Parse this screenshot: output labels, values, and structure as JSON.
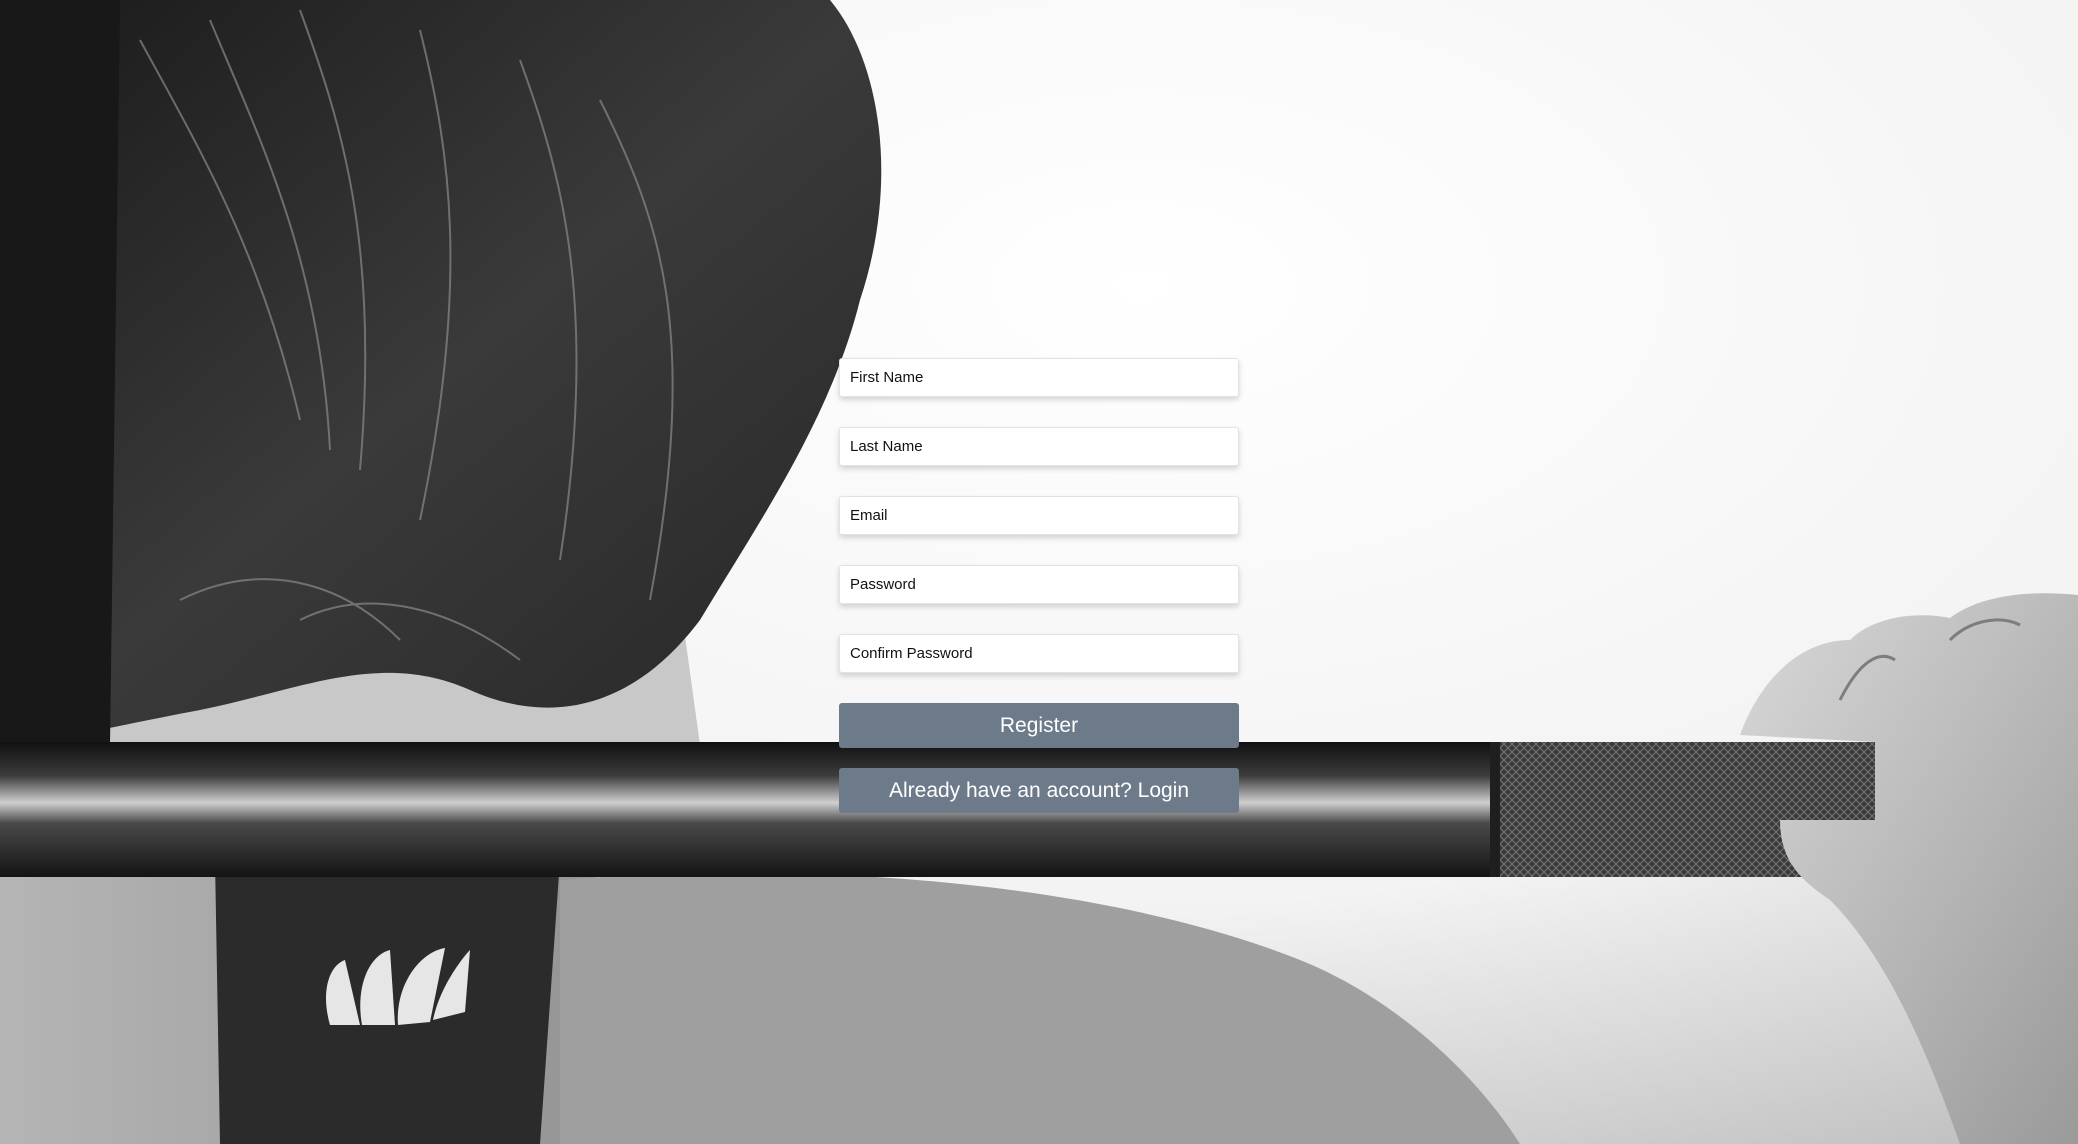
{
  "form": {
    "first_name_placeholder": "First Name",
    "last_name_placeholder": "Last Name",
    "email_placeholder": "Email",
    "password_placeholder": "Password",
    "confirm_password_placeholder": "Confirm Password",
    "register_label": "Register",
    "login_label": "Already have an account? Login"
  },
  "colors": {
    "button": "#6c7a89",
    "button_text": "#ffffff",
    "field_bg": "#ffffff"
  },
  "background": {
    "description_icon": "weightlifting-photo-background"
  }
}
